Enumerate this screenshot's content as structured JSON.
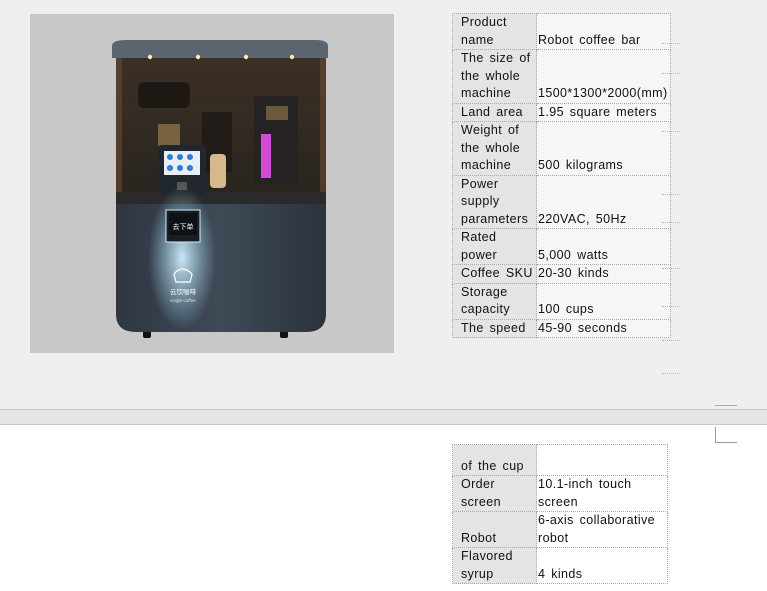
{
  "top_table": [
    {
      "label": "Product name",
      "value": "Robot coffee bar"
    },
    {
      "label": "The size of the whole machine",
      "value": "1500*1300*2000(mm)"
    },
    {
      "label": "Land area",
      "value": "1.95 square meters"
    },
    {
      "label": "Weight of the whole machine",
      "value": "500 kilograms"
    },
    {
      "label": "Power supply parameters",
      "value": "220VAC, 50Hz"
    },
    {
      "label": "Rated power",
      "value": "5,000 watts"
    },
    {
      "label": "Coffee SKU",
      "value": " 20-30 kinds"
    },
    {
      "label": "Storage capacity",
      "value": "100 cups"
    },
    {
      "label": "The speed",
      "value": "45-90 seconds"
    }
  ],
  "bottom_table": [
    {
      "label": "of the cup",
      "value": ""
    },
    {
      "label": "Order screen",
      "value": "10.1-inch touch screen"
    },
    {
      "label": "Robot",
      "value": " 6-axis collaborative robot"
    },
    {
      "label": "Flavored syrup",
      "value": "4 kinds"
    }
  ],
  "photo": {
    "kiosk_screen_text": "去下单",
    "brand_text": "云饮咖啡",
    "brand_sub": "single coffee",
    "colors": {
      "backdrop": "#c8c8c8",
      "body": "#3a4450",
      "glow": "#9fd8f4",
      "accent_light": "#d24ad8"
    }
  }
}
